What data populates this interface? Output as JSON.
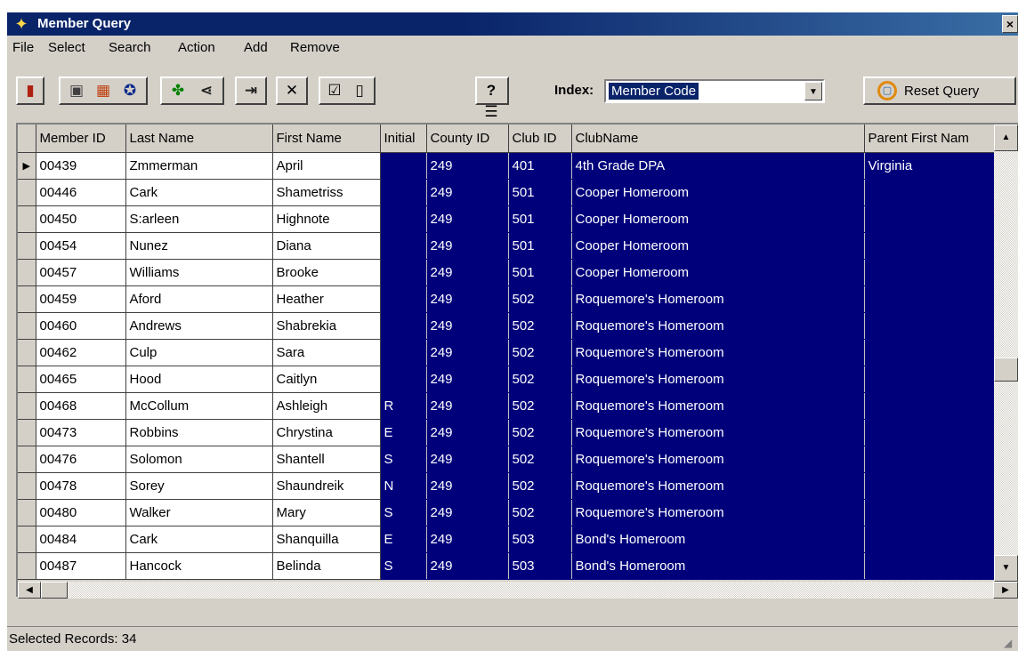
{
  "window": {
    "title": "Member Query",
    "app_icon": "wand-icon",
    "close_label": "×"
  },
  "menu": [
    "File",
    "Select",
    "Search",
    "Action",
    "Add",
    "Remove"
  ],
  "toolbar": {
    "index_label": "Index:",
    "index_value": "Member Code",
    "index_dropdown_glyph": "▼",
    "reset_label": "Reset Query",
    "buttons": [
      {
        "name": "exit-door-icon",
        "glyph": "▮",
        "color": "#b02010"
      },
      {
        "name": "picture-icon",
        "glyph": "▣",
        "color": "#404040"
      },
      {
        "name": "photo-grid-icon",
        "glyph": "▦",
        "color": "#c04010"
      },
      {
        "name": "award-ribbon-icon",
        "glyph": "✪",
        "color": "#0a2a8a"
      },
      {
        "name": "group-members-icon",
        "glyph": "✤",
        "color": "#008000"
      },
      {
        "name": "tree-branch-icon",
        "glyph": "⋖",
        "color": "#202020"
      },
      {
        "name": "export-arrow-icon",
        "glyph": "⇥",
        "color": "#202020"
      },
      {
        "name": "delete-x-icon",
        "glyph": "✕",
        "color": "#000000"
      },
      {
        "name": "checkbox-icon",
        "glyph": "☑",
        "color": "#000000"
      },
      {
        "name": "new-page-icon",
        "glyph": "▯",
        "color": "#000000"
      },
      {
        "name": "query-list-icon",
        "glyph": "?☰",
        "color": "#000000"
      }
    ]
  },
  "grid": {
    "columns": [
      "Member ID",
      "Last Name",
      "First Name",
      "Initial",
      "County ID",
      "Club ID",
      "ClubName",
      "Parent First Nam"
    ],
    "current_row_glyph": "▶",
    "rows": [
      [
        "00439",
        "Zmmerman",
        "April",
        "",
        "249",
        "401",
        "4th Grade DPA",
        "Virginia"
      ],
      [
        "00446",
        "Cark",
        "Shametriss",
        "",
        "249",
        "501",
        "Cooper Homeroom",
        ""
      ],
      [
        "00450",
        "S:arleen",
        "Highnote",
        "",
        "249",
        "501",
        "Cooper Homeroom",
        ""
      ],
      [
        "00454",
        "Nunez",
        "Diana",
        "",
        "249",
        "501",
        "Cooper Homeroom",
        ""
      ],
      [
        "00457",
        "Williams",
        "Brooke",
        "",
        "249",
        "501",
        "Cooper Homeroom",
        ""
      ],
      [
        "00459",
        "Aford",
        "Heather",
        "",
        "249",
        "502",
        "Roquemore's Homeroom",
        ""
      ],
      [
        "00460",
        "Andrews",
        "Shabrekia",
        "",
        "249",
        "502",
        "Roquemore's Homeroom",
        ""
      ],
      [
        "00462",
        "Culp",
        "Sara",
        "",
        "249",
        "502",
        "Roquemore's Homeroom",
        ""
      ],
      [
        "00465",
        "Hood",
        "Caitlyn",
        "",
        "249",
        "502",
        "Roquemore's Homeroom",
        ""
      ],
      [
        "00468",
        "McCollum",
        "Ashleigh",
        "R",
        "249",
        "502",
        "Roquemore's Homeroom",
        ""
      ],
      [
        "00473",
        "Robbins",
        "Chrystina",
        "E",
        "249",
        "502",
        "Roquemore's Homeroom",
        ""
      ],
      [
        "00476",
        "Solomon",
        "Shantell",
        "S",
        "249",
        "502",
        "Roquemore's Homeroom",
        ""
      ],
      [
        "00478",
        "Sorey",
        "Shaundreik",
        "N",
        "249",
        "502",
        "Roquemore's Homeroom",
        ""
      ],
      [
        "00480",
        "Walker",
        "Mary",
        "S",
        "249",
        "502",
        "Roquemore's Homeroom",
        ""
      ],
      [
        "00484",
        "Cark",
        "Shanquilla",
        "E",
        "249",
        "503",
        "Bond's Homeroom",
        ""
      ],
      [
        "00487",
        "Hancock",
        "Belinda",
        "S",
        "249",
        "503",
        "Bond's Homeroom",
        ""
      ]
    ]
  },
  "scrollbars": {
    "up": "▲",
    "down": "▼",
    "left": "◀",
    "right": "▶"
  },
  "status": {
    "text": "Selected Records: 34",
    "grip": "◢"
  },
  "colors": {
    "titlebar": "#0a246a",
    "selection": "#00007b",
    "face": "#d4d0c8"
  }
}
